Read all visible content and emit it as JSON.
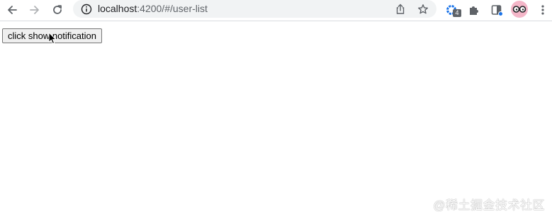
{
  "browser": {
    "url_host": "localhost",
    "url_rest": ":4200/#/user-list",
    "extension_badge": "4",
    "icons": {
      "back": "arrow-left-icon",
      "forward": "arrow-right-icon",
      "reload": "reload-icon",
      "info": "info-icon",
      "share": "share-icon",
      "bookmark": "star-icon",
      "extension": "gear-extension-icon",
      "extensions_menu": "puzzle-icon",
      "side_panel": "side-panel-icon",
      "profile": "avatar-glasses-icon",
      "menu": "kebab-menu-icon"
    }
  },
  "page": {
    "button_label": "click show notification"
  },
  "watermark": "@稀土掘金技术社区",
  "colors": {
    "omnibox_bg": "#f1f3f4",
    "icon": "#5f6368",
    "extension_accent": "#1a73e8",
    "avatar_bg": "#f4b6c8"
  }
}
